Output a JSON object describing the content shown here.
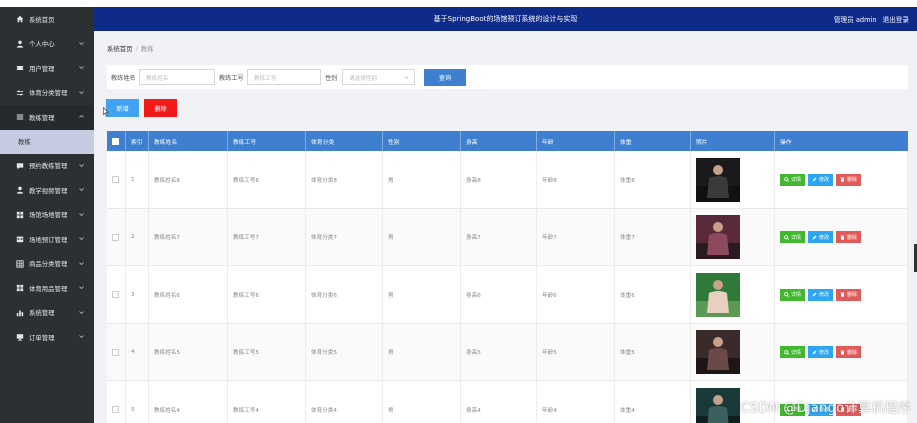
{
  "header": {
    "title": "基于SpringBoot的场馆预订系统的设计与实现",
    "user_role": "管理员 admin",
    "logout": "退出登录"
  },
  "sidebar": {
    "items": [
      {
        "label": "系统首页",
        "icon": "home-icon"
      },
      {
        "label": "个人中心",
        "icon": "user-icon"
      },
      {
        "label": "用户管理",
        "icon": "ticket-icon"
      },
      {
        "label": "体育分类管理",
        "icon": "sliders-icon"
      },
      {
        "label": "教练管理",
        "icon": "menu-icon"
      },
      {
        "label": "预约教练管理",
        "icon": "chat-icon"
      },
      {
        "label": "教学视频管理",
        "icon": "user-icon"
      },
      {
        "label": "场馆场地管理",
        "icon": "grid-icon"
      },
      {
        "label": "场地预订管理",
        "icon": "calendar-icon"
      },
      {
        "label": "商品分类管理",
        "icon": "table-icon"
      },
      {
        "label": "体育用品管理",
        "icon": "grid-icon"
      },
      {
        "label": "系统管理",
        "icon": "chart-icon"
      },
      {
        "label": "订单管理",
        "icon": "monitor-icon"
      }
    ],
    "sub_item": "教练"
  },
  "breadcrumb": {
    "home": "系统首页",
    "current": "教练"
  },
  "search": {
    "name_label": "教练姓名",
    "name_placeholder": "教练姓名",
    "no_label": "教练工号",
    "no_placeholder": "教练工号",
    "gender_label": "性别",
    "gender_placeholder": "请选择性别",
    "query_button": "查询"
  },
  "actions": {
    "add": "新增",
    "delete": "删除"
  },
  "table": {
    "columns": [
      "索引",
      "教练姓名",
      "教练工号",
      "体育分类",
      "性别",
      "身高",
      "年龄",
      "体重",
      "照片",
      "操作"
    ],
    "rows": [
      {
        "index": "1",
        "name": "教练姓名8",
        "no": "教练工号8",
        "category": "体育分类8",
        "gender": "男",
        "height": "身高8",
        "age": "年龄8",
        "weight": "体重8"
      },
      {
        "index": "2",
        "name": "教练姓名7",
        "no": "教练工号7",
        "category": "体育分类7",
        "gender": "男",
        "height": "身高7",
        "age": "年龄7",
        "weight": "体重7"
      },
      {
        "index": "3",
        "name": "教练姓名6",
        "no": "教练工号6",
        "category": "体育分类6",
        "gender": "男",
        "height": "身高6",
        "age": "年龄6",
        "weight": "体重6"
      },
      {
        "index": "4",
        "name": "教练姓名5",
        "no": "教练工号5",
        "category": "体育分类5",
        "gender": "男",
        "height": "身高5",
        "age": "年龄5",
        "weight": "体重5"
      },
      {
        "index": "5",
        "name": "教练姓名4",
        "no": "教练工号4",
        "category": "体育分类4",
        "gender": "男",
        "height": "身高4",
        "age": "年龄4",
        "weight": "体重4"
      }
    ],
    "row_actions": {
      "detail": "详情",
      "edit": "修改",
      "remove": "删除"
    }
  },
  "watermark": "CSDN @Django计算机程序",
  "colors": {
    "header": "#0f2b8a",
    "sidebar": "#2c3033",
    "primary": "#3f7fcf",
    "danger": "#f21919",
    "success": "#41b82e"
  }
}
